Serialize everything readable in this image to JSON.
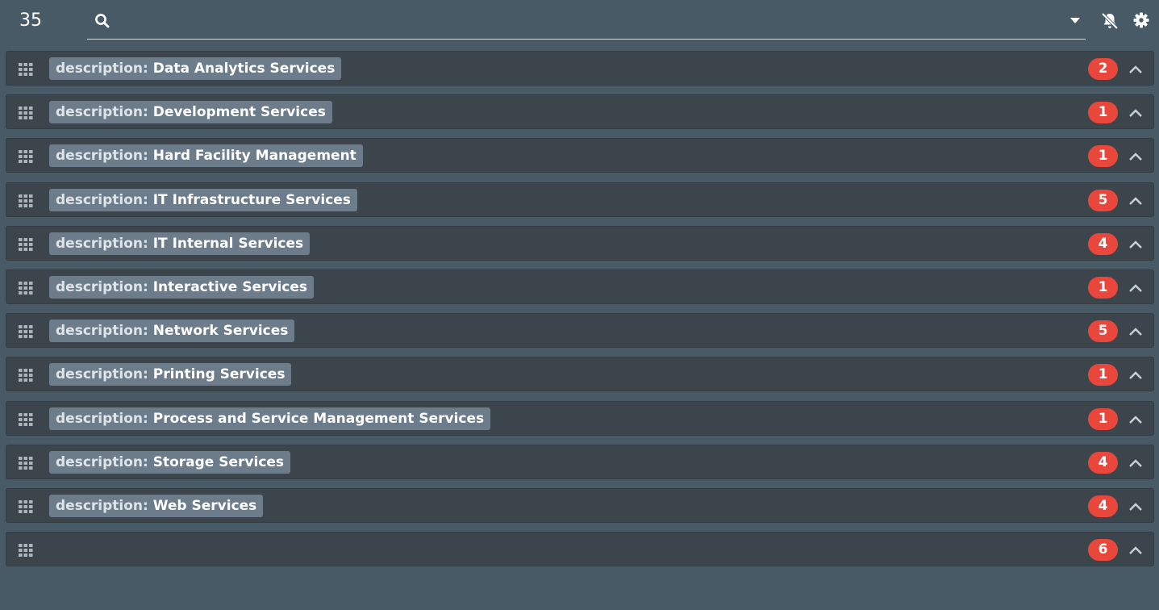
{
  "header": {
    "total_count": "35",
    "search": {
      "value": "",
      "placeholder": ""
    }
  },
  "groups": [
    {
      "key": "description: ",
      "value": "Data Analytics Services",
      "count": "2"
    },
    {
      "key": "description: ",
      "value": "Development Services",
      "count": "1"
    },
    {
      "key": "description: ",
      "value": "Hard Facility Management",
      "count": "1"
    },
    {
      "key": "description: ",
      "value": "IT Infrastructure Services",
      "count": "5"
    },
    {
      "key": "description: ",
      "value": "IT Internal Services",
      "count": "4"
    },
    {
      "key": "description: ",
      "value": "Interactive Services",
      "count": "1"
    },
    {
      "key": "description: ",
      "value": "Network Services",
      "count": "5"
    },
    {
      "key": "description: ",
      "value": "Printing Services",
      "count": "1"
    },
    {
      "key": "description: ",
      "value": "Process and Service Management Services",
      "count": "1"
    },
    {
      "key": "description: ",
      "value": "Storage Services",
      "count": "4"
    },
    {
      "key": "description: ",
      "value": "Web Services",
      "count": "4"
    },
    {
      "key": "",
      "value": "",
      "count": "6"
    }
  ],
  "icons": {
    "search": "search-icon",
    "dropdown": "caret-down-icon",
    "notifications": "bell-slash-icon",
    "settings": "gear-icon",
    "drag": "grid-drag-icon",
    "collapse": "chevron-up-icon"
  },
  "colors": {
    "background": "#475a65",
    "row_background": "#3d454c",
    "pill_background": "#6d7c8b",
    "badge": "#e9473c"
  }
}
